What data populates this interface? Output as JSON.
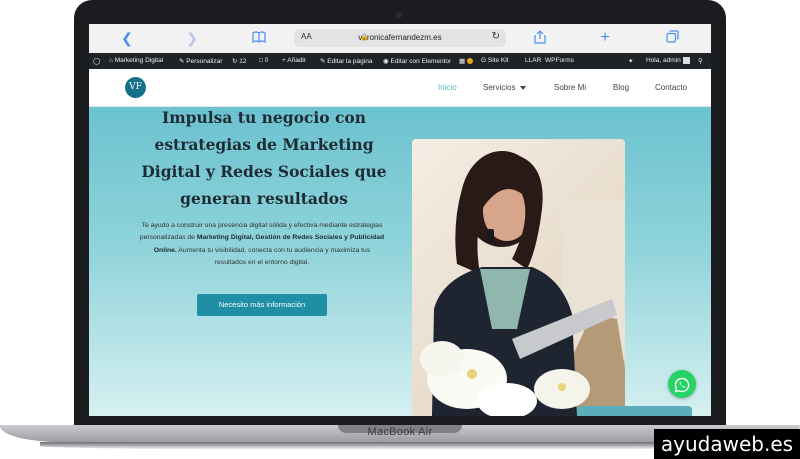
{
  "browser": {
    "address_prefix": "AA",
    "url": "veronicafernandezm.es",
    "icons": {
      "back": "chevron-left-icon",
      "forward": "chevron-right-icon",
      "bookmarks": "book-icon",
      "reload": "reload-icon",
      "share": "share-icon",
      "new_tab": "plus-icon",
      "tabs": "tabs-icon"
    }
  },
  "wp_admin_bar": {
    "site_name": "Marketing Digital",
    "customize": "Personalizar",
    "updates_count": "12",
    "comments_count": "0",
    "new": "Añadir",
    "edit_page": "Editar la página",
    "edit_elementor": "Editar con Elementor",
    "site_kit": "Site Kit",
    "llar": "LLAR",
    "wpforms": "WPForms",
    "greeting": "Hola, admin"
  },
  "site_header": {
    "logo_text": "VF",
    "nav": [
      {
        "label": "Inicio",
        "active": true
      },
      {
        "label": "Servicios",
        "has_dropdown": true
      },
      {
        "label": "Sobre Mi"
      },
      {
        "label": "Blog"
      },
      {
        "label": "Contacto"
      }
    ]
  },
  "hero": {
    "headline": "Impulsa tu negocio con estrategias de Marketing Digital y Redes Sociales que generan resultados",
    "text_intro": "Te ayudo a construir una presencia digital sólida y efectiva mediante estrategias personalizadas de ",
    "text_bold": "Marketing Digital, Gestión de Redes Sociales y Publicidad Online.",
    "text_outro": " Aumenta tu visibilidad, conecta con tu audiencia y maximiza tus resultados en el entorno digital.",
    "cta_label": "Necesito más información"
  },
  "device": {
    "model": "MacBook Air"
  },
  "watermark": "ayudaweb.es",
  "colors": {
    "accent": "#1f8fa6",
    "hero_top": "#6bc2cf",
    "whatsapp": "#25d366",
    "wp_bar": "#1d2327"
  }
}
